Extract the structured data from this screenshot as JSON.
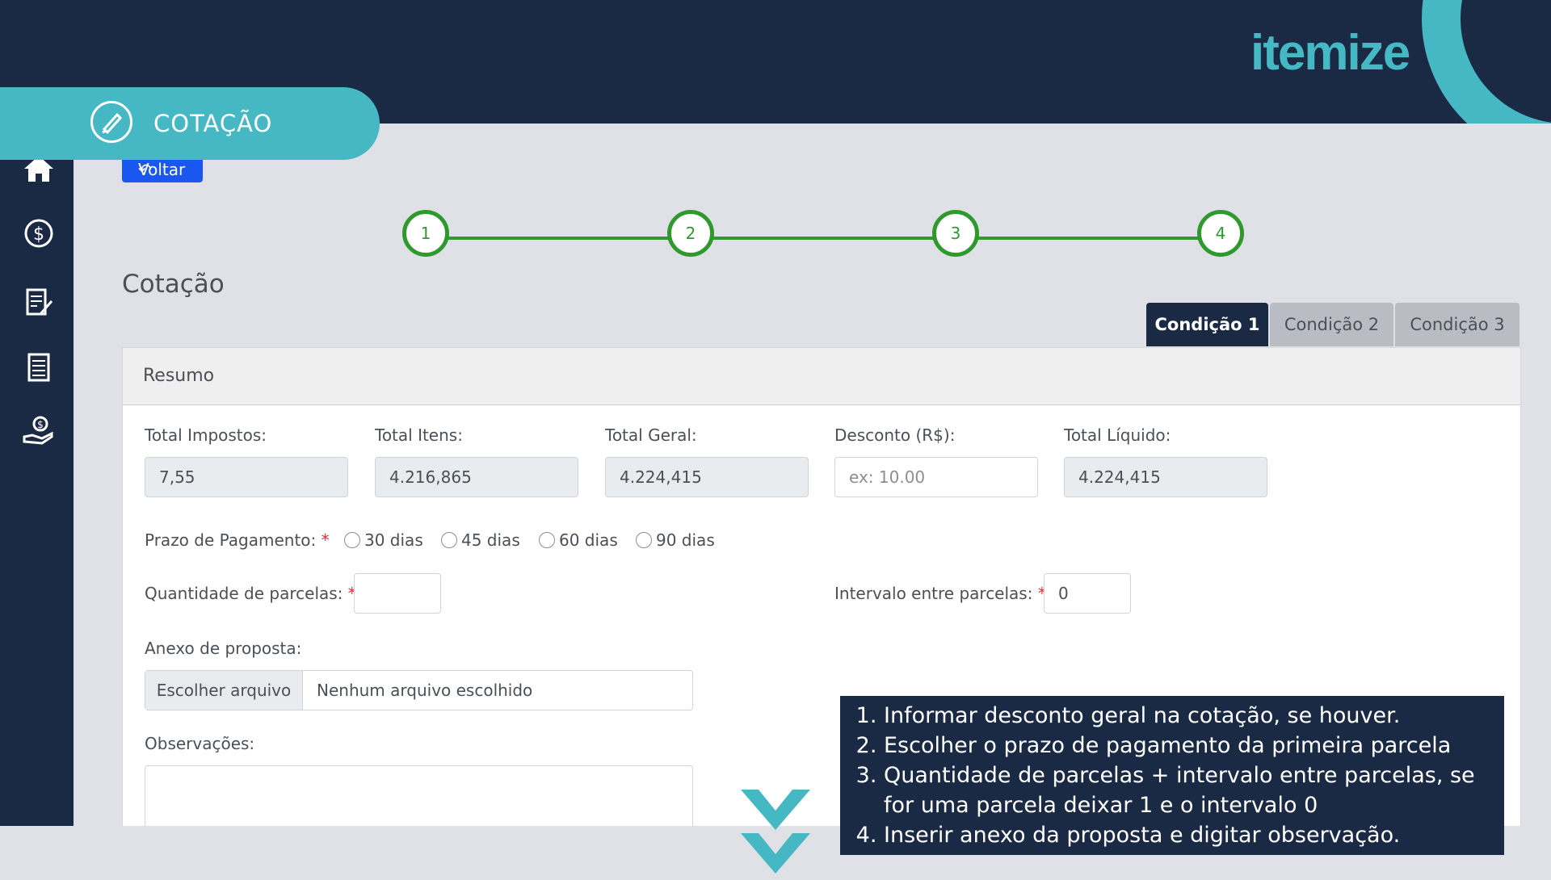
{
  "brand": {
    "name": "itemize",
    "color": "#45b8c4"
  },
  "section_pill": {
    "label": "COTAÇÃO",
    "icon": "pen-icon"
  },
  "sidebar": {
    "items": [
      {
        "icon": "home-icon"
      },
      {
        "icon": "dollar-icon"
      },
      {
        "icon": "edit-document-icon"
      },
      {
        "icon": "document-list-icon"
      },
      {
        "icon": "hand-money-icon"
      }
    ]
  },
  "back_button": {
    "label": "Voltar"
  },
  "steps": [
    "1",
    "2",
    "3",
    "4"
  ],
  "page_title": "Cotação",
  "tabs": [
    "Condição 1",
    "Condição 2",
    "Condição 3"
  ],
  "card": {
    "header": "Resumo",
    "fields": {
      "total_impostos": {
        "label": "Total Impostos:",
        "value": "7,55"
      },
      "total_itens": {
        "label": "Total Itens:",
        "value": "4.216,865"
      },
      "total_geral": {
        "label": "Total Geral:",
        "value": "4.224,415"
      },
      "desconto": {
        "label": "Desconto (R$):",
        "placeholder": "ex: 10.00"
      },
      "total_liquido": {
        "label": "Total Líquido:",
        "value": "4.224,415"
      }
    },
    "prazo": {
      "label": "Prazo de Pagamento:",
      "required": "*",
      "options": [
        "30 dias",
        "45 dias",
        "60 dias",
        "90 dias"
      ]
    },
    "parcelas": {
      "label": "Quantidade de parcelas:",
      "required": "*",
      "value": ""
    },
    "intervalo": {
      "label": "Intervalo entre parcelas:",
      "required": "*",
      "value": "0"
    },
    "anexo": {
      "label": "Anexo de proposta:",
      "button": "Escolher arquivo",
      "status": "Nenhum arquivo escolhido"
    },
    "observacoes": {
      "label": "Observações:"
    }
  },
  "instructions": [
    "Informar desconto geral na cotação, se houver.",
    "Escolher o prazo de pagamento da primeira parcela",
    "Quantidade de parcelas  + intervalo entre parcelas, se for uma parcela deixar 1 e o intervalo 0",
    "Inserir anexo da proposta e digitar observação."
  ],
  "colors": {
    "navy": "#1b2a44",
    "teal": "#45b8c4",
    "step_green": "#2e9a2e",
    "primary_blue": "#1a56f0"
  }
}
